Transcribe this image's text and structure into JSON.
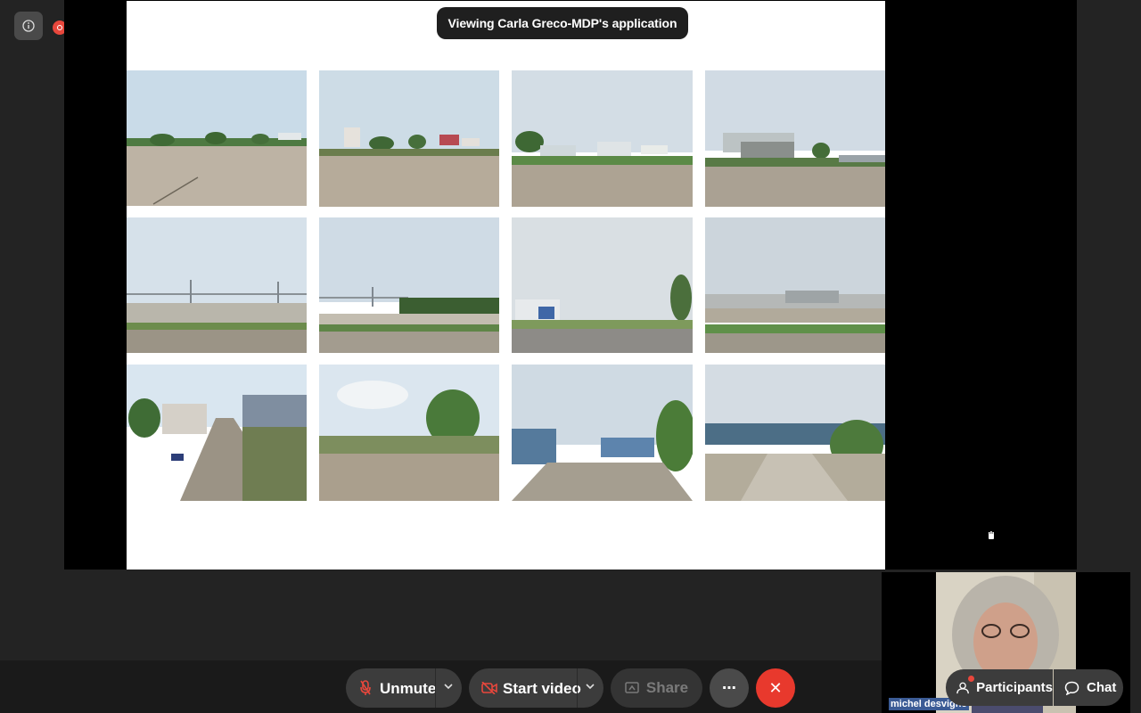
{
  "banner": {
    "text": "Viewing Carla Greco-MDP's application"
  },
  "video": {
    "participant_name": "michel desvigne"
  },
  "toolbar": {
    "unmute_label": "Unmute",
    "start_video_label": "Start video",
    "share_label": "Share",
    "more_label": "⋯",
    "leave_label": "✕"
  },
  "side": {
    "participants_label": "Participants",
    "chat_label": "Chat"
  },
  "colors": {
    "accent_red": "#e8392d",
    "toolbar_bg": "#1a1a1a",
    "button_bg": "#3c3c3c",
    "name_tag_bg": "#3b5b95"
  },
  "icons": {
    "info": "info-icon",
    "recording": "recording-icon",
    "mic_off": "mic-off-icon",
    "camera_off": "camera-off-icon",
    "share": "share-screen-icon",
    "more": "more-icon",
    "leave": "leave-icon",
    "participants": "participants-icon",
    "chat": "chat-icon"
  }
}
